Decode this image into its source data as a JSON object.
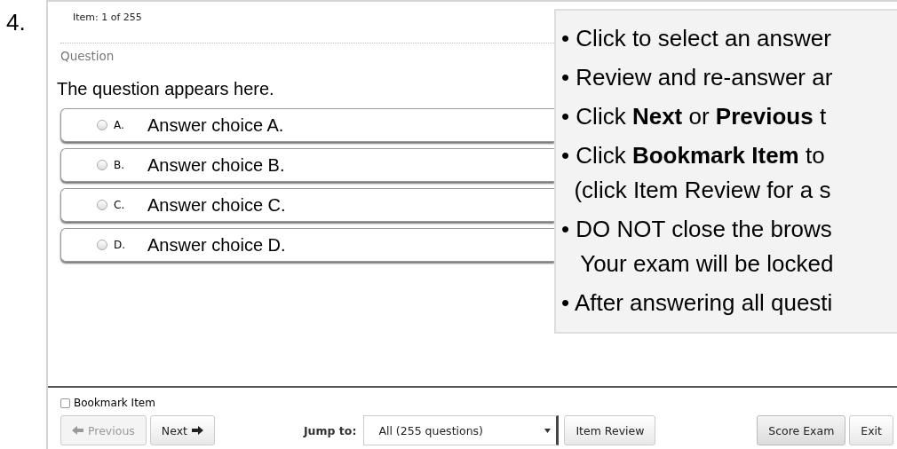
{
  "question_number": "4.",
  "item_counter": "Item: 1 of 255",
  "section_label": "Question",
  "question": "The question appears here.",
  "choices": [
    {
      "letter": "A.",
      "text": "Answer choice A.",
      "selected": false
    },
    {
      "letter": "B.",
      "text": "Answer choice B.",
      "selected": false
    },
    {
      "letter": "C.",
      "text": "Answer choice C.",
      "selected": false
    },
    {
      "letter": "D.",
      "text": "Answer choice D.",
      "selected": false
    }
  ],
  "instructions": [
    "• Click to select an answer",
    "• Review and re-answer ar",
    "• Click **Next** or **Previous** t",
    "• Click **Bookmark Item** to",
    "  (click Item Review for a s",
    "• DO NOT close the brows",
    "   Your exam will be locked",
    "• After answering all questi"
  ],
  "bookmark": {
    "label": "Bookmark Item",
    "checked": false
  },
  "previous_button": {
    "label": "Previous",
    "disabled": true
  },
  "next_button": {
    "label": "Next",
    "disabled": false
  },
  "jump_to": {
    "label": "Jump to:",
    "value": "All (255 questions)"
  },
  "item_review_button": "Item Review",
  "score_exam_button": "Score Exam",
  "exit_button": "Exit"
}
